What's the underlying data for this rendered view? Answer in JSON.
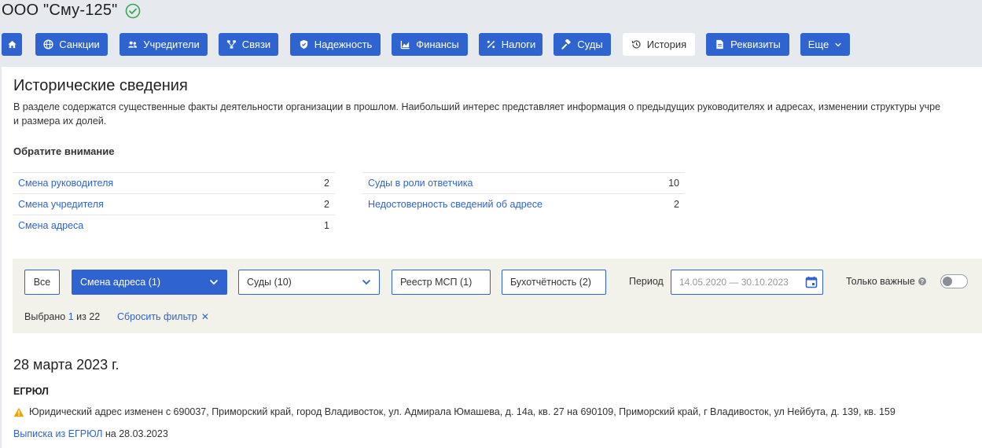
{
  "company": {
    "name": "ООО \"Сму-125\""
  },
  "tabs": [
    {
      "icon": "home-icon",
      "label": ""
    },
    {
      "icon": "globe-icon",
      "label": "Санкции"
    },
    {
      "icon": "users-icon",
      "label": "Учредители"
    },
    {
      "icon": "network-icon",
      "label": "Связи"
    },
    {
      "icon": "shield-icon",
      "label": "Надежность"
    },
    {
      "icon": "chart-icon",
      "label": "Финансы"
    },
    {
      "icon": "percent-icon",
      "label": "Налоги"
    },
    {
      "icon": "gavel-icon",
      "label": "Суды"
    },
    {
      "icon": "history-icon",
      "label": "История"
    },
    {
      "icon": "document-icon",
      "label": "Реквизиты"
    },
    {
      "icon": "chevron-down-icon",
      "label": "Еще"
    }
  ],
  "section": {
    "title": "Исторические сведения",
    "description_line1": "В разделе содержатся существенные факты деятельности организации в прошлом. Наибольший интерес представляет информация о предыдущих руководителях и адресах, изменении структуры учре",
    "description_line2": "и размера их долей.",
    "attention_title": "Обратите внимание"
  },
  "stats_left": [
    {
      "label": "Смена руководителя",
      "count": "2"
    },
    {
      "label": "Смена учредителя",
      "count": "2"
    },
    {
      "label": "Смена адреса",
      "count": "1"
    }
  ],
  "stats_right": [
    {
      "label": "Суды в роли ответчика",
      "count": "10"
    },
    {
      "label": "Недостоверность сведений об адресе",
      "count": "2"
    }
  ],
  "filters": {
    "all_label": "Все",
    "address_change": "Смена адреса (1)",
    "courts": "Суды (10)",
    "msp_registry": "Реестр МСП (1)",
    "accounting": "Бухотчётность (2)",
    "period_label": "Период",
    "period_value": "14.05.2020 — 30.10.2023",
    "only_important": "Только важные",
    "help_glyph": "?",
    "selected_prefix": "Выбрано",
    "selected_count": "1",
    "selected_suffix": "из 22",
    "reset_label": "Сбросить фильтр",
    "reset_glyph": "✕"
  },
  "event": {
    "date": "28 марта 2023 г.",
    "source": "ЕГРЮЛ",
    "text": "Юридический адрес изменен с 690037, Приморский край, город Владивосток, ул. Адмирала Юмашева, д. 14а, кв. 27 на 690109, Приморский край, г Владивосток, ул Нейбута, д. 139, кв. 159",
    "extract_link": "Выписка из ЕГРЮЛ",
    "extract_suffix": " на 28.03.2023"
  },
  "colors": {
    "accent": "#2f63d0",
    "check": "#3aa757",
    "warning": "#f0a500"
  }
}
